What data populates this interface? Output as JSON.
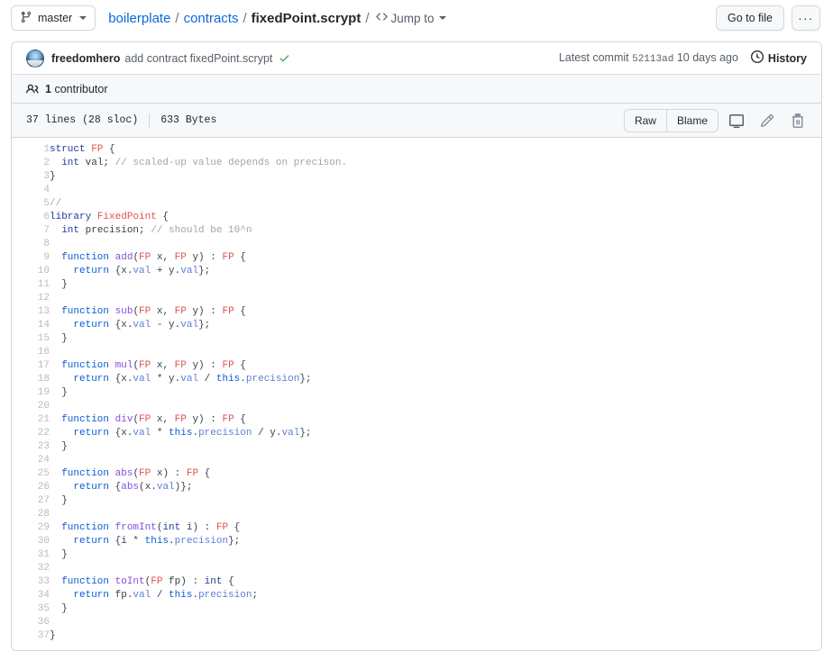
{
  "topbar": {
    "branch": {
      "label": "master",
      "icon": "git-branch-icon"
    },
    "breadcrumb": {
      "repo": "boilerplate",
      "folder": "contracts",
      "file": "fixedPoint.scrypt",
      "separator": "/"
    },
    "jump_to": {
      "label": "Jump to",
      "icon": "code-icon"
    },
    "go_to_file": "Go to file",
    "kebab": "···"
  },
  "commit": {
    "author": "freedomhero",
    "message": "add contract fixedPoint.scrypt",
    "status_icon": "check-icon",
    "latest_commit_label": "Latest commit",
    "sha": "52113ad",
    "time": "10 days ago",
    "history_label": "History",
    "history_icon": "clock-icon"
  },
  "contributors": {
    "icon": "people-icon",
    "count": "1",
    "label": "contributor"
  },
  "file_toolbar": {
    "lines": "37 lines (28 sloc)",
    "size": "633 Bytes",
    "raw": "Raw",
    "blame": "Blame",
    "desktop_icon": "desktop-download-icon",
    "edit_icon": "pencil-icon",
    "delete_icon": "trash-icon"
  },
  "code": {
    "language": "scrypt",
    "lines": [
      {
        "n": "1",
        "tokens": [
          {
            "t": "struct ",
            "c": "k"
          },
          {
            "t": "FP",
            "c": "ty"
          },
          {
            "t": " {",
            "c": "pl"
          }
        ]
      },
      {
        "n": "2",
        "tokens": [
          {
            "t": "  int",
            "c": "k"
          },
          {
            "t": " val; ",
            "c": "pl"
          },
          {
            "t": "// scaled-up value depends on precison.",
            "c": "cm"
          }
        ]
      },
      {
        "n": "3",
        "tokens": [
          {
            "t": "}",
            "c": "pl"
          }
        ]
      },
      {
        "n": "4",
        "tokens": []
      },
      {
        "n": "5",
        "tokens": [
          {
            "t": "//",
            "c": "cm"
          }
        ]
      },
      {
        "n": "6",
        "tokens": [
          {
            "t": "library ",
            "c": "k"
          },
          {
            "t": "FixedPoint",
            "c": "ty"
          },
          {
            "t": " {",
            "c": "pl"
          }
        ]
      },
      {
        "n": "7",
        "tokens": [
          {
            "t": "  int",
            "c": "k"
          },
          {
            "t": " precision; ",
            "c": "pl"
          },
          {
            "t": "// should be 10^n",
            "c": "cm"
          }
        ]
      },
      {
        "n": "8",
        "tokens": []
      },
      {
        "n": "9",
        "tokens": [
          {
            "t": "  ",
            "c": "pl"
          },
          {
            "t": "function ",
            "c": "kw"
          },
          {
            "t": "add",
            "c": "fn"
          },
          {
            "t": "(",
            "c": "pl"
          },
          {
            "t": "FP",
            "c": "ty"
          },
          {
            "t": " x, ",
            "c": "pl"
          },
          {
            "t": "FP",
            "c": "ty"
          },
          {
            "t": " y) : ",
            "c": "pl"
          },
          {
            "t": "FP",
            "c": "ty"
          },
          {
            "t": " {",
            "c": "pl"
          }
        ]
      },
      {
        "n": "10",
        "tokens": [
          {
            "t": "    ",
            "c": "pl"
          },
          {
            "t": "return",
            "c": "kw"
          },
          {
            "t": " {x.",
            "c": "pl"
          },
          {
            "t": "val",
            "c": "pr"
          },
          {
            "t": " + y.",
            "c": "pl"
          },
          {
            "t": "val",
            "c": "pr"
          },
          {
            "t": "};",
            "c": "pl"
          }
        ]
      },
      {
        "n": "11",
        "tokens": [
          {
            "t": "  }",
            "c": "pl"
          }
        ]
      },
      {
        "n": "12",
        "tokens": []
      },
      {
        "n": "13",
        "tokens": [
          {
            "t": "  ",
            "c": "pl"
          },
          {
            "t": "function ",
            "c": "kw"
          },
          {
            "t": "sub",
            "c": "fn"
          },
          {
            "t": "(",
            "c": "pl"
          },
          {
            "t": "FP",
            "c": "ty"
          },
          {
            "t": " x, ",
            "c": "pl"
          },
          {
            "t": "FP",
            "c": "ty"
          },
          {
            "t": " y) : ",
            "c": "pl"
          },
          {
            "t": "FP",
            "c": "ty"
          },
          {
            "t": " {",
            "c": "pl"
          }
        ]
      },
      {
        "n": "14",
        "tokens": [
          {
            "t": "    ",
            "c": "pl"
          },
          {
            "t": "return",
            "c": "kw"
          },
          {
            "t": " {x.",
            "c": "pl"
          },
          {
            "t": "val",
            "c": "pr"
          },
          {
            "t": " - y.",
            "c": "pl"
          },
          {
            "t": "val",
            "c": "pr"
          },
          {
            "t": "};",
            "c": "pl"
          }
        ]
      },
      {
        "n": "15",
        "tokens": [
          {
            "t": "  }",
            "c": "pl"
          }
        ]
      },
      {
        "n": "16",
        "tokens": []
      },
      {
        "n": "17",
        "tokens": [
          {
            "t": "  ",
            "c": "pl"
          },
          {
            "t": "function ",
            "c": "kw"
          },
          {
            "t": "mul",
            "c": "fn"
          },
          {
            "t": "(",
            "c": "pl"
          },
          {
            "t": "FP",
            "c": "ty"
          },
          {
            "t": " x, ",
            "c": "pl"
          },
          {
            "t": "FP",
            "c": "ty"
          },
          {
            "t": " y) : ",
            "c": "pl"
          },
          {
            "t": "FP",
            "c": "ty"
          },
          {
            "t": " {",
            "c": "pl"
          }
        ]
      },
      {
        "n": "18",
        "tokens": [
          {
            "t": "    ",
            "c": "pl"
          },
          {
            "t": "return",
            "c": "kw"
          },
          {
            "t": " {x.",
            "c": "pl"
          },
          {
            "t": "val",
            "c": "pr"
          },
          {
            "t": " * y.",
            "c": "pl"
          },
          {
            "t": "val",
            "c": "pr"
          },
          {
            "t": " / ",
            "c": "pl"
          },
          {
            "t": "this",
            "c": "kw"
          },
          {
            "t": ".",
            "c": "pl"
          },
          {
            "t": "precision",
            "c": "pr"
          },
          {
            "t": "};",
            "c": "pl"
          }
        ]
      },
      {
        "n": "19",
        "tokens": [
          {
            "t": "  }",
            "c": "pl"
          }
        ]
      },
      {
        "n": "20",
        "tokens": []
      },
      {
        "n": "21",
        "tokens": [
          {
            "t": "  ",
            "c": "pl"
          },
          {
            "t": "function ",
            "c": "kw"
          },
          {
            "t": "div",
            "c": "fn"
          },
          {
            "t": "(",
            "c": "pl"
          },
          {
            "t": "FP",
            "c": "ty"
          },
          {
            "t": " x, ",
            "c": "pl"
          },
          {
            "t": "FP",
            "c": "ty"
          },
          {
            "t": " y) : ",
            "c": "pl"
          },
          {
            "t": "FP",
            "c": "ty"
          },
          {
            "t": " {",
            "c": "pl"
          }
        ]
      },
      {
        "n": "22",
        "tokens": [
          {
            "t": "    ",
            "c": "pl"
          },
          {
            "t": "return",
            "c": "kw"
          },
          {
            "t": " {x.",
            "c": "pl"
          },
          {
            "t": "val",
            "c": "pr"
          },
          {
            "t": " * ",
            "c": "pl"
          },
          {
            "t": "this",
            "c": "kw"
          },
          {
            "t": ".",
            "c": "pl"
          },
          {
            "t": "precision",
            "c": "pr"
          },
          {
            "t": " / y.",
            "c": "pl"
          },
          {
            "t": "val",
            "c": "pr"
          },
          {
            "t": "};",
            "c": "pl"
          }
        ]
      },
      {
        "n": "23",
        "tokens": [
          {
            "t": "  }",
            "c": "pl"
          }
        ]
      },
      {
        "n": "24",
        "tokens": []
      },
      {
        "n": "25",
        "tokens": [
          {
            "t": "  ",
            "c": "pl"
          },
          {
            "t": "function ",
            "c": "kw"
          },
          {
            "t": "abs",
            "c": "fn"
          },
          {
            "t": "(",
            "c": "pl"
          },
          {
            "t": "FP",
            "c": "ty"
          },
          {
            "t": " x) : ",
            "c": "pl"
          },
          {
            "t": "FP",
            "c": "ty"
          },
          {
            "t": " {",
            "c": "pl"
          }
        ]
      },
      {
        "n": "26",
        "tokens": [
          {
            "t": "    ",
            "c": "pl"
          },
          {
            "t": "return",
            "c": "kw"
          },
          {
            "t": " {",
            "c": "pl"
          },
          {
            "t": "abs",
            "c": "fn"
          },
          {
            "t": "(x.",
            "c": "pl"
          },
          {
            "t": "val",
            "c": "pr"
          },
          {
            "t": ")};",
            "c": "pl"
          }
        ]
      },
      {
        "n": "27",
        "tokens": [
          {
            "t": "  }",
            "c": "pl"
          }
        ]
      },
      {
        "n": "28",
        "tokens": []
      },
      {
        "n": "29",
        "tokens": [
          {
            "t": "  ",
            "c": "pl"
          },
          {
            "t": "function ",
            "c": "kw"
          },
          {
            "t": "fromInt",
            "c": "fn"
          },
          {
            "t": "(",
            "c": "pl"
          },
          {
            "t": "int",
            "c": "k"
          },
          {
            "t": " i) : ",
            "c": "pl"
          },
          {
            "t": "FP",
            "c": "ty"
          },
          {
            "t": " {",
            "c": "pl"
          }
        ]
      },
      {
        "n": "30",
        "tokens": [
          {
            "t": "    ",
            "c": "pl"
          },
          {
            "t": "return",
            "c": "kw"
          },
          {
            "t": " {i * ",
            "c": "pl"
          },
          {
            "t": "this",
            "c": "kw"
          },
          {
            "t": ".",
            "c": "pl"
          },
          {
            "t": "precision",
            "c": "pr"
          },
          {
            "t": "};",
            "c": "pl"
          }
        ]
      },
      {
        "n": "31",
        "tokens": [
          {
            "t": "  }",
            "c": "pl"
          }
        ]
      },
      {
        "n": "32",
        "tokens": []
      },
      {
        "n": "33",
        "tokens": [
          {
            "t": "  ",
            "c": "pl"
          },
          {
            "t": "function ",
            "c": "kw"
          },
          {
            "t": "toInt",
            "c": "fn"
          },
          {
            "t": "(",
            "c": "pl"
          },
          {
            "t": "FP",
            "c": "ty"
          },
          {
            "t": " fp) : ",
            "c": "pl"
          },
          {
            "t": "int",
            "c": "k"
          },
          {
            "t": " {",
            "c": "pl"
          }
        ]
      },
      {
        "n": "34",
        "tokens": [
          {
            "t": "    ",
            "c": "pl"
          },
          {
            "t": "return",
            "c": "kw"
          },
          {
            "t": " fp.",
            "c": "pl"
          },
          {
            "t": "val",
            "c": "pr"
          },
          {
            "t": " / ",
            "c": "pl"
          },
          {
            "t": "this",
            "c": "kw"
          },
          {
            "t": ".",
            "c": "pl"
          },
          {
            "t": "precision",
            "c": "pr"
          },
          {
            "t": ";",
            "c": "pl"
          }
        ]
      },
      {
        "n": "35",
        "tokens": [
          {
            "t": "  }",
            "c": "pl"
          }
        ]
      },
      {
        "n": "36",
        "tokens": []
      },
      {
        "n": "37",
        "tokens": [
          {
            "t": "}",
            "c": "pl"
          }
        ]
      }
    ]
  },
  "colors": {
    "link": "#0969da",
    "border": "#d0d7de",
    "muted": "#57606a",
    "header_bg": "#f6f8fa",
    "success": "#2da44e"
  }
}
